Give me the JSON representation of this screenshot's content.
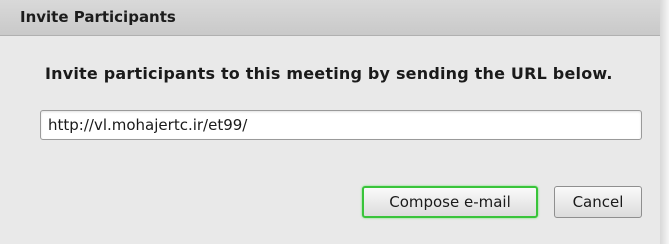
{
  "dialog": {
    "title": "Invite Participants",
    "instruction": "Invite participants to this meeting by sending the URL below.",
    "url_value": "http://vl.mohajertc.ir/et99/",
    "buttons": {
      "compose_label": "Compose e-mail",
      "cancel_label": "Cancel"
    },
    "colors": {
      "focus_ring": "#39c43a",
      "background": "#e9e9e9",
      "titlebar": "#d2d2d2"
    }
  }
}
